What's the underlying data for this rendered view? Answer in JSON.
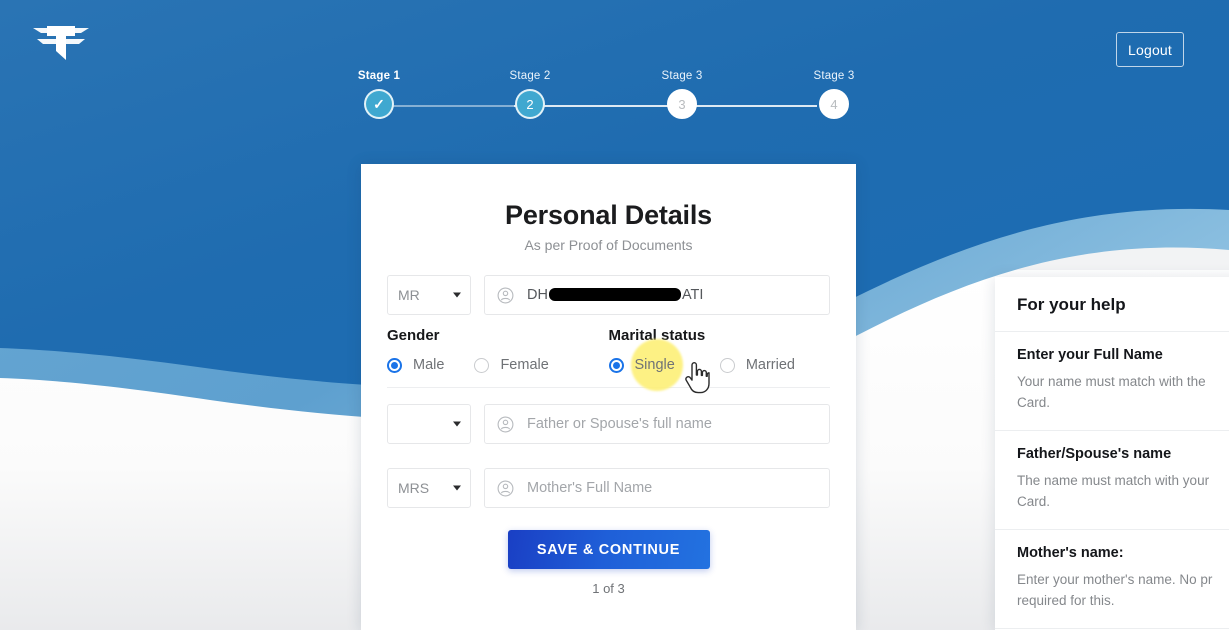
{
  "brand": {
    "logo_icon": "double-f-wing-logo"
  },
  "header": {
    "logout_label": "Logout"
  },
  "stepper": {
    "steps": [
      {
        "label": "Stage 1",
        "marker": "✓",
        "state": "done"
      },
      {
        "label": "Stage 2",
        "marker": "2",
        "state": "active"
      },
      {
        "label": "Stage 3",
        "marker": "3",
        "state": "todo"
      },
      {
        "label": "Stage 3",
        "marker": "4",
        "state": "todo"
      }
    ]
  },
  "form": {
    "title": "Personal Details",
    "subtitle": "As per Proof of Documents",
    "name_row": {
      "salutation_value": "MR",
      "name_prefix": "DH",
      "name_suffix": "ATI",
      "icon": "user-circle-icon"
    },
    "gender": {
      "title": "Gender",
      "options": [
        {
          "label": "Male",
          "selected": true
        },
        {
          "label": "Female",
          "selected": false
        }
      ]
    },
    "marital_status": {
      "title": "Marital status",
      "options": [
        {
          "label": "Single",
          "selected": true,
          "highlighted": true
        },
        {
          "label": "Married",
          "selected": false,
          "highlighted": false
        }
      ]
    },
    "father_row": {
      "salutation_value": "",
      "placeholder": "Father or Spouse's full name",
      "icon": "user-circle-icon"
    },
    "mother_row": {
      "salutation_value": "MRS",
      "placeholder": "Mother's Full Name",
      "icon": "user-circle-icon"
    },
    "submit_label": "SAVE & CONTINUE",
    "page_count": "1 of 3"
  },
  "help": {
    "heading": "For your help",
    "items": [
      {
        "title": "Enter your Full Name",
        "body": "Your name must match with the Card."
      },
      {
        "title": "Father/Spouse's name",
        "body": "The name must match with your Card."
      },
      {
        "title": "Mother's name:",
        "body": "Enter your mother's name. No pr required for this."
      }
    ]
  },
  "colors": {
    "wave_dark": "#1f6cb0",
    "wave_mid": "#3d8bc4",
    "wave_light": "#7fb4da",
    "step_active": "#3fa8d0",
    "radio_accent": "#1a73e8",
    "submit_blue": "#1f5fd8",
    "highlight_yellow": "#fdf07a"
  }
}
